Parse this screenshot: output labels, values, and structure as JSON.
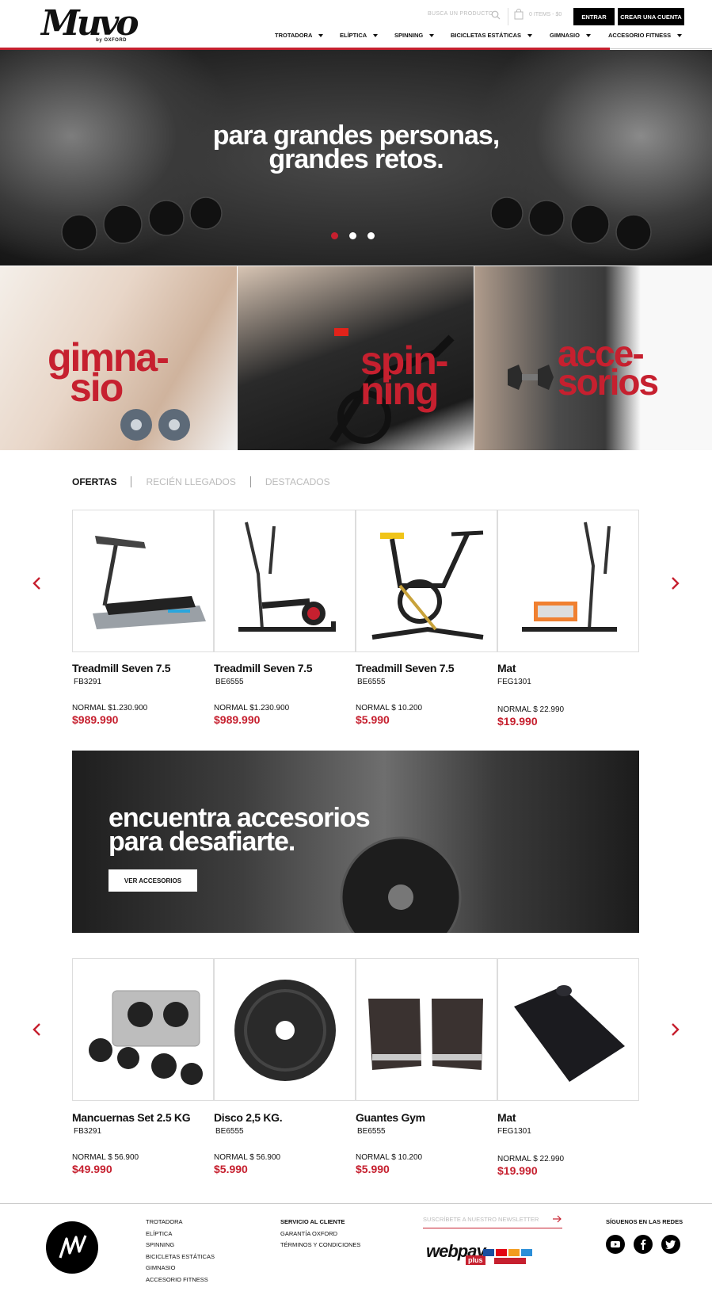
{
  "brand": {
    "logo_text": "Muvo",
    "by": "by OXFORD"
  },
  "header": {
    "search_placeholder": "BUSCA UN PRODUCTO",
    "cart": "0 ITEMS - $0",
    "login": "ENTRAR",
    "register": "CREAR UNA CUENTA"
  },
  "nav": [
    {
      "label": "TROTADORA"
    },
    {
      "label": "ELÍPTICA"
    },
    {
      "label": "SPINNING"
    },
    {
      "label": "BICICLETAS ESTÁTICAS"
    },
    {
      "label": "GIMNASIO"
    },
    {
      "label": "ACCESORIO FITNESS"
    }
  ],
  "hero": {
    "line1": "para grandes personas,",
    "line2": "grandes retos."
  },
  "categories": [
    {
      "line1": "gimna-",
      "line2": "sio"
    },
    {
      "line1": "spin-",
      "line2": "ning"
    },
    {
      "line1": "acce-",
      "line2": "sorios"
    }
  ],
  "tabs": [
    "OFERTAS",
    "RECIÉN LLEGADOS",
    "DESTACADOS"
  ],
  "products": [
    {
      "name": "Treadmill Seven 7.5",
      "code": "FB3291",
      "normal": "NORMAL $1.230.900",
      "sale": "$989.990"
    },
    {
      "name": "Treadmill Seven 7.5",
      "code": "BE6555",
      "normal": "NORMAL $1.230.900",
      "sale": "$989.990"
    },
    {
      "name": "Treadmill Seven 7.5",
      "code": "BE6555",
      "normal": "NORMAL $ 10.200",
      "sale": "$5.990"
    },
    {
      "name": "Mat",
      "code": "FEG1301",
      "normal": "NORMAL $ 22.990",
      "sale": "$19.990"
    }
  ],
  "banner": {
    "line1": "encuentra accesorios",
    "line2": "para desafiarte.",
    "button": "VER ACCESORIOS"
  },
  "accessories": [
    {
      "name": "Mancuernas Set 2.5 KG",
      "code": "FB3291",
      "normal": "NORMAL $ 56.900",
      "sale": "$49.990"
    },
    {
      "name": "Disco 2,5 KG.",
      "code": "BE6555",
      "normal": "NORMAL $ 56.900",
      "sale": "$5.990"
    },
    {
      "name": "Guantes Gym",
      "code": "BE6555",
      "normal": "NORMAL $ 10.200",
      "sale": "$5.990"
    },
    {
      "name": "Mat",
      "code": "FEG1301",
      "normal": "NORMAL $ 22.990",
      "sale": "$19.990"
    }
  ],
  "footer": {
    "categories": [
      "TROTADORA",
      "ELÍPTICA",
      "SPINNING",
      "BICICLETAS ESTÁTICAS",
      "GIMNASIO",
      "ACCESORIO FITNESS"
    ],
    "service_title": "SERVICIO AL CLIENTE",
    "service_links": [
      "GARANTÍA OXFORD",
      "TÉRMINOS Y CONDICIONES"
    ],
    "newsletter_placeholder": "SUSCRÍBETE A NUESTRO NEWSLETTER",
    "payment_logo_text": "webpay",
    "payment_plus": "plus",
    "social_title": "SÍGUENOS EN LAS REDES"
  },
  "colors": {
    "accent": "#c6202f",
    "dark": "#000000"
  },
  "icons": [
    "search-icon",
    "cart-icon",
    "chevron-left-icon",
    "chevron-right-icon",
    "arrow-right-icon",
    "youtube-icon",
    "facebook-icon",
    "twitter-icon"
  ]
}
